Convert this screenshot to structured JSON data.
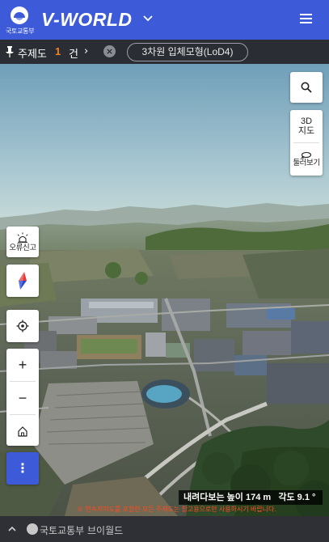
{
  "header": {
    "org_name": "국토교통부",
    "brand": "V-WORLD",
    "icons": [
      "government-emblem-icon",
      "chevron-down-icon",
      "hamburger-menu-icon"
    ]
  },
  "theme_bar": {
    "label": "주제도",
    "count": "1",
    "unit": "건",
    "arrow": "›",
    "clear_symbol": "×",
    "layer_name": "3차원 입체모형(LoD4)"
  },
  "controls": {
    "view3d_label_1": "3D",
    "view3d_label_2": "지도",
    "orbit_label": "둘러보기",
    "report_label": "오류신고",
    "zoom_in": "+",
    "zoom_out": "−",
    "more": "⋮"
  },
  "status": {
    "height_label": "내려다보는 높이",
    "height_value": "174 m",
    "angle_label": "각도",
    "angle_value": "9.1 °",
    "notice": "※ 연속지적도를 포함한 모든 주제도는 참고용으로만 사용하시기 바랍니다."
  },
  "footer": {
    "org_name": "국토교통부",
    "site_name": "브이월드"
  },
  "colors": {
    "brand_blue": "#3d5bd9",
    "dark_bar": "#2a2d33",
    "accent_orange": "#f5821f",
    "notice_red": "#ff4b1f"
  }
}
